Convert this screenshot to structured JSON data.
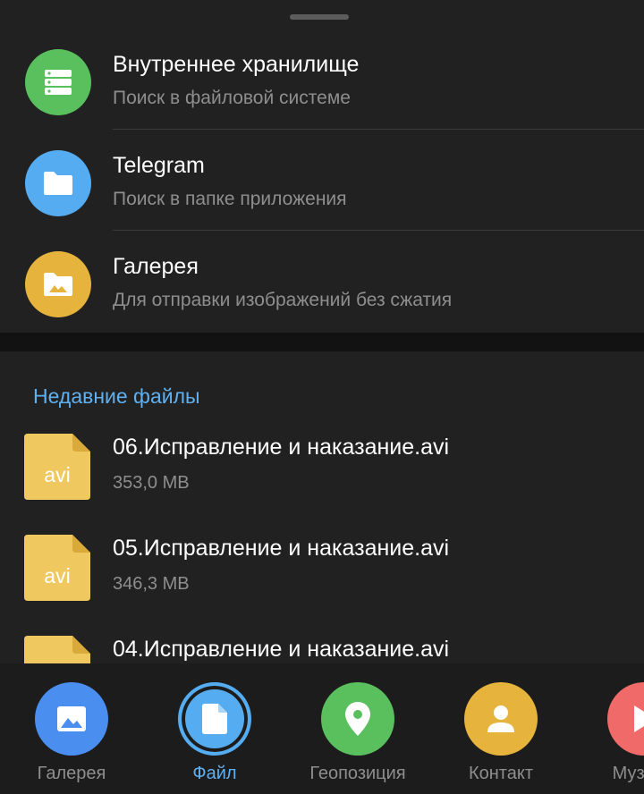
{
  "sources": [
    {
      "title": "Внутреннее хранилище",
      "subtitle": "Поиск в файловой системе",
      "icon": "storage-icon",
      "color": "#5ac05e"
    },
    {
      "title": "Telegram",
      "subtitle": "Поиск в папке приложения",
      "icon": "folder-icon",
      "color": "#55acf0"
    },
    {
      "title": "Галерея",
      "subtitle": "Для отправки изображений без сжатия",
      "icon": "image-folder-icon",
      "color": "#e6b33c"
    }
  ],
  "recent": {
    "header": "Недавние файлы",
    "files": [
      {
        "name": "06.Исправление и наказание.avi",
        "size": "353,0 MB",
        "ext": "avi"
      },
      {
        "name": "05.Исправление и наказание.avi",
        "size": "346,3 MB",
        "ext": "avi"
      },
      {
        "name": "04.Исправление и наказание.avi",
        "size": "",
        "ext": "avi"
      }
    ]
  },
  "tabs": [
    {
      "label": "Галерея",
      "icon": "gallery-icon",
      "color": "#4a8ef0",
      "active": false
    },
    {
      "label": "Файл",
      "icon": "file-icon",
      "color": "#55acf0",
      "active": true
    },
    {
      "label": "Геопозиция",
      "icon": "location-pin-icon",
      "color": "#5ac05e",
      "active": false
    },
    {
      "label": "Контакт",
      "icon": "contact-icon",
      "color": "#e6b33c",
      "active": false
    },
    {
      "label": "Музыка",
      "icon": "music-icon",
      "color": "#f06a6a",
      "active": false
    }
  ],
  "colors": {
    "background": "#212121",
    "accent": "#5fb0f0",
    "file_icon": "#f0c860"
  }
}
